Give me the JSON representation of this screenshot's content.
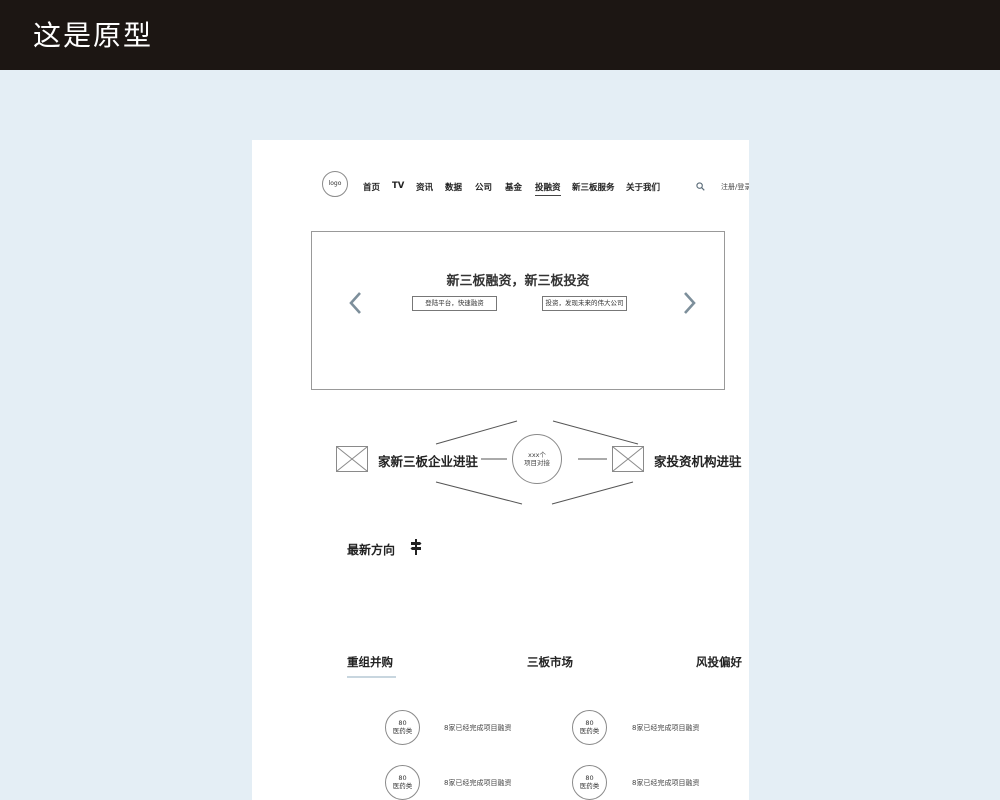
{
  "page_title": "这是原型",
  "header": {
    "logo": "logo",
    "nav": [
      "首页",
      "TV",
      "资讯",
      "数据",
      "公司",
      "基金",
      "投融资",
      "新三板服务",
      "关于我们"
    ],
    "active_nav": "投融资",
    "login": "注册/登录"
  },
  "banner": {
    "title": "新三板融资，新三板投资",
    "left_pill": "登陆平台，快速融资",
    "right_pill": "投资，发现未来的伟大公司"
  },
  "connect": {
    "left_label": "家新三板企业进驻",
    "right_label": "家投资机构进驻",
    "hub_count": "xxx个",
    "hub_label": "项目对接"
  },
  "latest": {
    "title": "最新方向"
  },
  "tabs": [
    "重组并购",
    "三板市场",
    "风投偏好"
  ],
  "items": [
    {
      "number": "80",
      "category": "医药类",
      "desc": "8家已经完成项目融资"
    },
    {
      "number": "80",
      "category": "医药类",
      "desc": "8家已经完成项目融资"
    },
    {
      "number": "80",
      "category": "医药类",
      "desc": "8家已经完成项目融资"
    },
    {
      "number": "80",
      "category": "医药类",
      "desc": "8家已经完成项目融资"
    }
  ],
  "colors": {
    "topbar": "#1c1613",
    "background": "#e4eef5",
    "tab_underline": "#c8d6df"
  },
  "icons": {
    "search": "search-icon",
    "prev": "chevron-left-icon",
    "next": "chevron-right-icon",
    "signpost": "signpost-icon",
    "image": "image-placeholder-icon"
  }
}
